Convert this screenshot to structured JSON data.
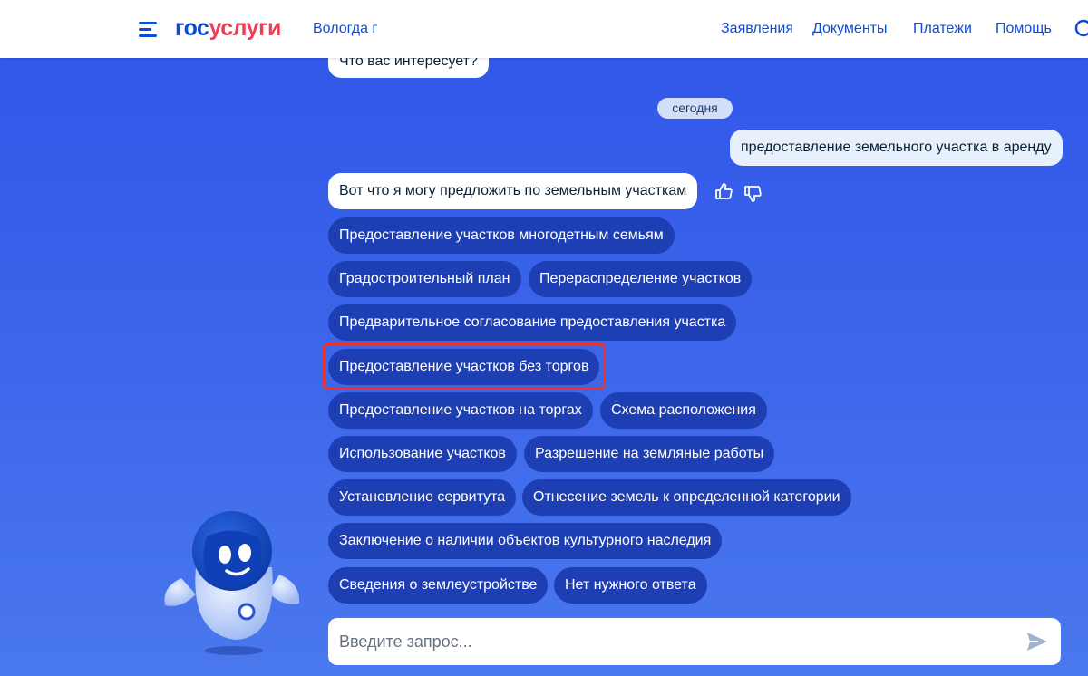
{
  "header": {
    "logo": {
      "part1": "гос",
      "part2": "услуги"
    },
    "city": "Вологда г",
    "nav": [
      "Заявления",
      "Документы",
      "Платежи",
      "Помощь"
    ]
  },
  "chat": {
    "prev_bot_message": "Что вас интересует?",
    "date_separator": "сегодня",
    "user_message": "предоставление земельного участка в аренду",
    "bot_message": "Вот что я могу предложить по земельным участкам",
    "options": [
      "Предоставление участков многодетным семьям",
      "Градостроительный план",
      "Перераспределение участков",
      "Предварительное согласование предоставления участка",
      "Предоставление участков без торгов",
      "Предоставление участков на торгах",
      "Схема расположения",
      "Использование участков",
      "Разрешение на земляные работы",
      "Установление сервитута",
      "Отнесение земель к определенной категории",
      "Заключение о наличии объектов культурного наследия",
      "Сведения о землеустройстве",
      "Нет нужного ответа"
    ],
    "input_placeholder": "Введите запрос..."
  },
  "colors": {
    "brand_blue": "#0d4cd3",
    "brand_red": "#ee3f58",
    "chip_bg": "#1e3fb3",
    "highlight": "#e8342a"
  }
}
